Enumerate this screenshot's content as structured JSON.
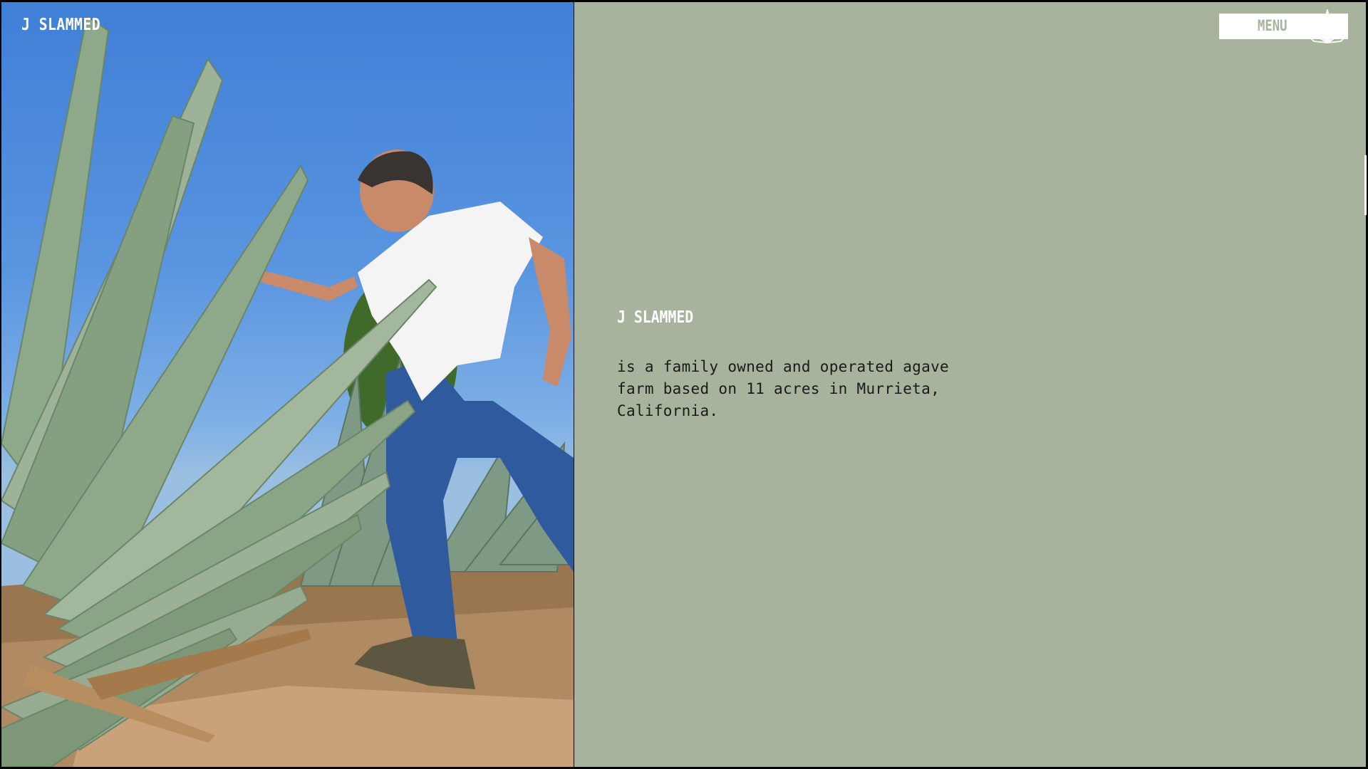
{
  "header": {
    "brand": "J SLAMMED",
    "menu_label": "MENU",
    "menu_icon": "agave-icon"
  },
  "hero_image": {
    "subject": "photo-agave-farmer",
    "icon": "photo-icon"
  },
  "intro": {
    "title": "J SLAMMED",
    "description": "is a family owned and operated agave farm based on 11 acres in Murrieta, California."
  },
  "colors": {
    "panel_green": "#a7b39d",
    "text_dark": "#1a1a1a",
    "white": "#ffffff",
    "sky_blue": "#4a86db"
  }
}
